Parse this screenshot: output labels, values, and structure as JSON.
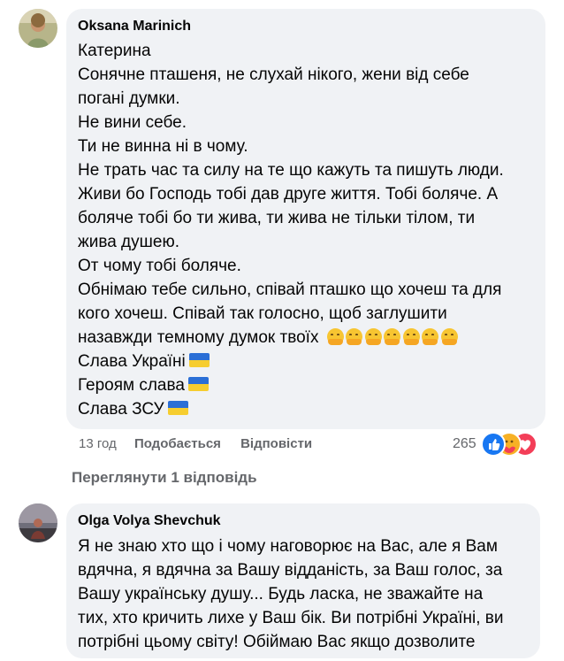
{
  "comment1": {
    "author": "Oksana Marinich",
    "lines": [
      "Катерина",
      "Сонячне пташеня, не слухай нікого, жени від себе",
      "погані думки.",
      "Не вини себе.",
      "Ти не винна ні в чому.",
      "Не трать час та силу на те що кажуть та пишуть люди.",
      "Живи бо Господь тобі дав друге життя. Тобі боляче. А",
      "боляче тобі бо ти жива, ти жива не тільки тілом, ти",
      "жива душею.",
      "От чому тобі боляче.",
      "Обнімаю тебе сильно, співай пташко що хочеш та для",
      "кого хочеш. Співай так голосно, щоб заглушити",
      "назавжди темному думок твоїх",
      "Слава Україні",
      "Героям слава",
      "Слава ЗСУ"
    ],
    "hug_emoji_count": 7,
    "time": "13 год",
    "like_label": "Подобається",
    "reply_label": "Відповісти",
    "reaction_count": "265",
    "reaction_icons": [
      "like-reaction",
      "care-reaction",
      "love-reaction"
    ],
    "view_replies": "Переглянути 1 відповідь"
  },
  "comment2": {
    "author": "Olga Volya Shevchuk",
    "lines": [
      "Я не знаю хто що і чому наговорює на Вас, але я Вам",
      "вдячна, я вдячна за Вашу відданість, за Ваш голос, за",
      "Вашу українську душу... Будь ласка, не зважайте на",
      "тих, хто кричить лихе у Ваш бік. Ви потрібні Україні, ви",
      "потрібні цьому світу! Обіймаю Вас якщо дозволите"
    ]
  },
  "colors": {
    "bubble": "#f0f2f5",
    "secondary_text": "#65676b",
    "flag_blue": "#2b6fd6",
    "flag_yellow": "#f6cd2f",
    "like_blue": "#1877f2",
    "love_red": "#f33e58"
  }
}
